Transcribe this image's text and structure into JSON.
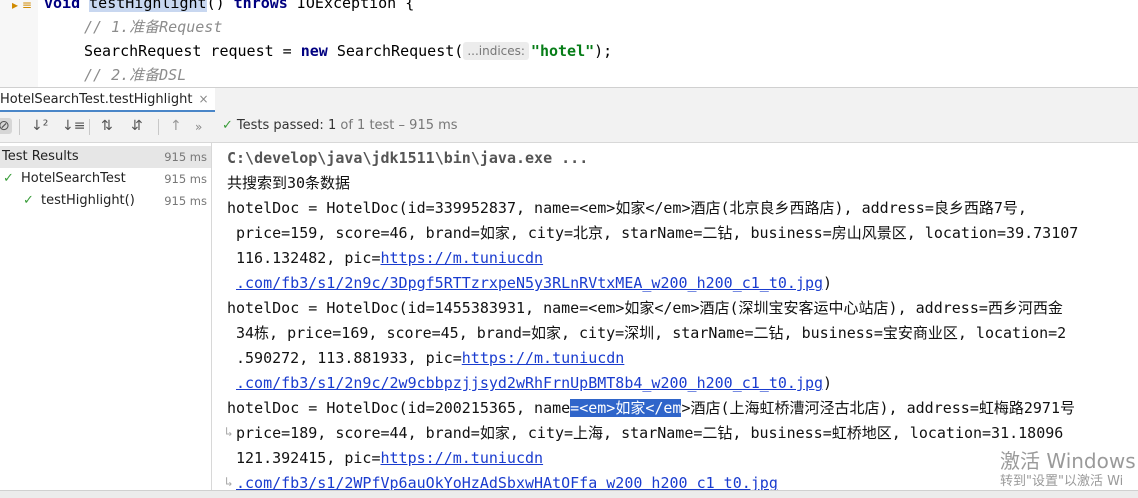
{
  "editor": {
    "line1": {
      "kw1": "void",
      "method": "testHighlight",
      "rest": "() ",
      "kw2": "throws",
      "exc": " IOException {"
    },
    "line2": "// 1.准备Request",
    "line3": {
      "pre": "SearchRequest request = ",
      "kw": "new",
      "mid": " SearchRequest(",
      "hint": "...indices:",
      "str": "\"hotel\"",
      "post": ");"
    },
    "line4": "// 2.准备DSL"
  },
  "run_tab": {
    "label": "HotelSearchTest.testHighlight",
    "close": "×"
  },
  "toolbar": {
    "status_icon": "✓",
    "status_label": "Tests passed:",
    "status_count": "1",
    "status_rest": "of 1 test – 915 ms"
  },
  "tree": {
    "root": {
      "label": "Test Results",
      "time": "915 ms"
    },
    "suite": {
      "label": "HotelSearchTest",
      "time": "915 ms"
    },
    "test": {
      "label": "testHighlight()",
      "time": "915 ms"
    }
  },
  "console": {
    "cmd": "C:\\develop\\java\\jdk1511\\bin\\java.exe ...",
    "summary": "共搜索到30条数据",
    "doc1": {
      "l1": "hotelDoc = HotelDoc(id=339952837, name=<em>如家</em>酒店(北京良乡西路店), address=良乡西路7号,",
      "l2": "price=159, score=46, brand=如家, city=北京, starName=二钻, business=房山风景区, location=39.73107",
      "l3_pre": "116.132482, pic=",
      "l3_link": "https://m.tuniucdn",
      "l4_link": ".com/fb3/s1/2n9c/3Dpgf5RTTzrxpeN5y3RLnRVtxMEA_w200_h200_c1_t0.jpg",
      "l4_post": ")"
    },
    "doc2": {
      "l1": "hotelDoc = HotelDoc(id=1455383931, name=<em>如家</em>酒店(深圳宝安客运中心站店), address=西乡河西金",
      "l2": "34栋, price=169, score=45, brand=如家, city=深圳, starName=二钻, business=宝安商业区, location=2",
      "l3_pre": ".590272, 113.881933, pic=",
      "l3_link": "https://m.tuniucdn",
      "l4_link": ".com/fb3/s1/2n9c/2w9cbbpzjjsyd2wRhFrnUpBMT8b4_w200_h200_c1_t0.jpg",
      "l4_post": ")"
    },
    "doc3": {
      "l1_pre": "hotelDoc = HotelDoc(id=200215365, name",
      "l1_sel": "=<em>如家</em",
      "l1_post": ">酒店(上海虹桥漕河泾古北店), address=虹梅路2971号",
      "l2": "price=189, score=44, brand=如家, city=上海, starName=二钻, business=虹桥地区, location=31.18096",
      "l3_pre": "121.392415, pic=",
      "l3_link": "https://m.tuniucdn",
      "l4_link": ".com/fb3/s1/2WPfVp6auOkYoHzAdSbxwHAtOFfa_w200_h200_c1_t0.jpg"
    }
  },
  "watermark": {
    "line1": "激活 Windows",
    "line2": "转到\"设置\"以激活 Wi"
  }
}
